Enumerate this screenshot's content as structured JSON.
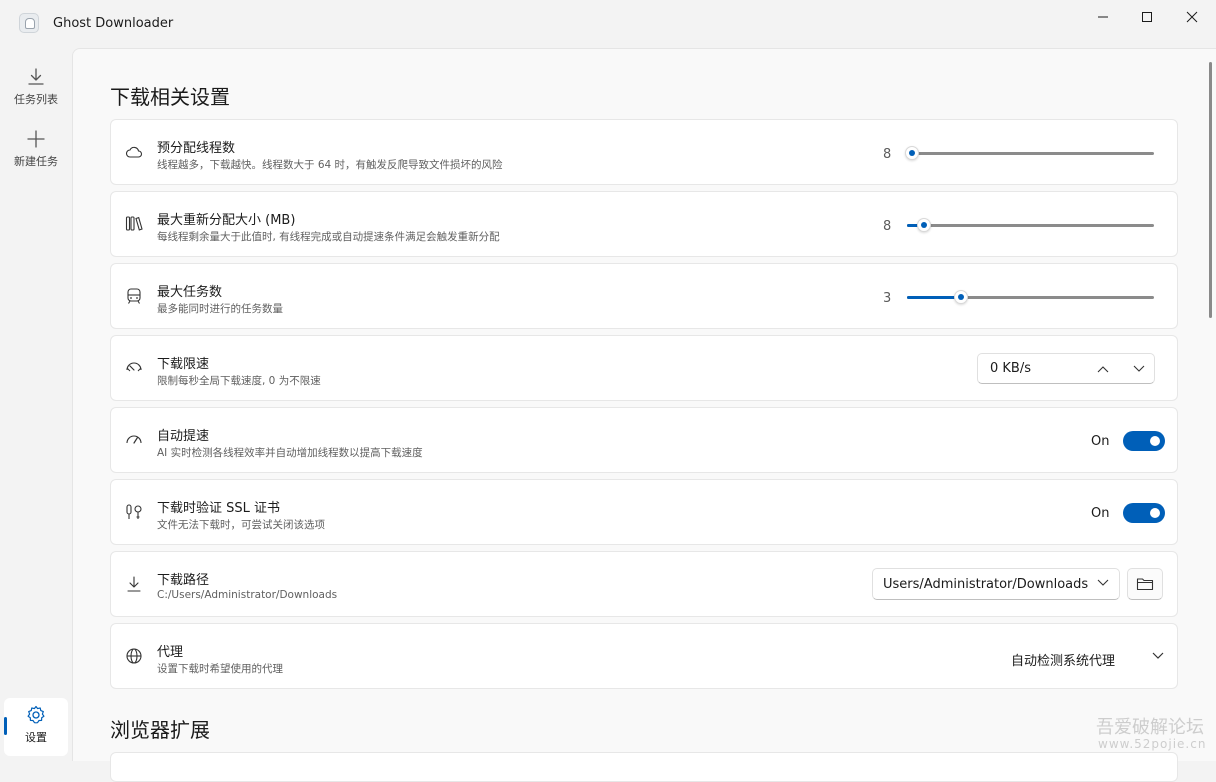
{
  "window": {
    "title": "Ghost Downloader"
  },
  "sidebar": {
    "items": [
      {
        "label": "任务列表",
        "icon": "download-icon"
      },
      {
        "label": "新建任务",
        "icon": "plus-icon"
      },
      {
        "label": "设置",
        "icon": "gear-icon",
        "selected": true
      }
    ]
  },
  "sections": {
    "download": {
      "title": "下载相关设置"
    },
    "browser": {
      "title": "浏览器扩展"
    }
  },
  "settings": {
    "threads": {
      "title": "预分配线程数",
      "desc": "线程越多，下载越快。线程数大于 64 时，有触发反爬导致文件损坏的风险",
      "value": "8",
      "level": 0.02,
      "icon": "cloud-icon"
    },
    "resegment": {
      "title": "最大重新分配大小 (MB)",
      "desc": "每线程剩余量大于此值时, 有线程完成或自动提速条件满足会触发重新分配",
      "value": "8",
      "level": 0.07,
      "icon": "library-icon"
    },
    "max_tasks": {
      "title": "最大任务数",
      "desc": "最多能同时进行的任务数量",
      "value": "3",
      "level": 0.22,
      "icon": "train-icon"
    },
    "speed_limit": {
      "title": "下载限速",
      "desc": "限制每秒全局下载速度, 0 为不限速",
      "value": "0 KB/s",
      "icon": "speedometer-icon"
    },
    "auto_speed": {
      "title": "自动提速",
      "desc": "AI 实时检测各线程效率并自动增加线程数以提高下载速度",
      "state": "On",
      "icon": "gauge-icon"
    },
    "ssl_verify": {
      "title": "下载时验证 SSL 证书",
      "desc": "文件无法下载时，可尝试关闭该选项",
      "state": "On",
      "icon": "certificate-icon"
    },
    "download_path": {
      "title": "下载路径",
      "desc": "C:/Users/Administrator/Downloads",
      "value": "Users/Administrator/Downloads",
      "icon": "download-icon"
    },
    "proxy": {
      "title": "代理",
      "desc": "设置下载时希望使用的代理",
      "value": "自动检测系统代理",
      "icon": "globe-icon"
    }
  },
  "watermark": {
    "line1": "吾爱破解论坛",
    "line2": "www.52pojie.cn"
  },
  "colors": {
    "accent": "#005fb8",
    "background": "#f3f3f3",
    "card": "#ffffff"
  }
}
